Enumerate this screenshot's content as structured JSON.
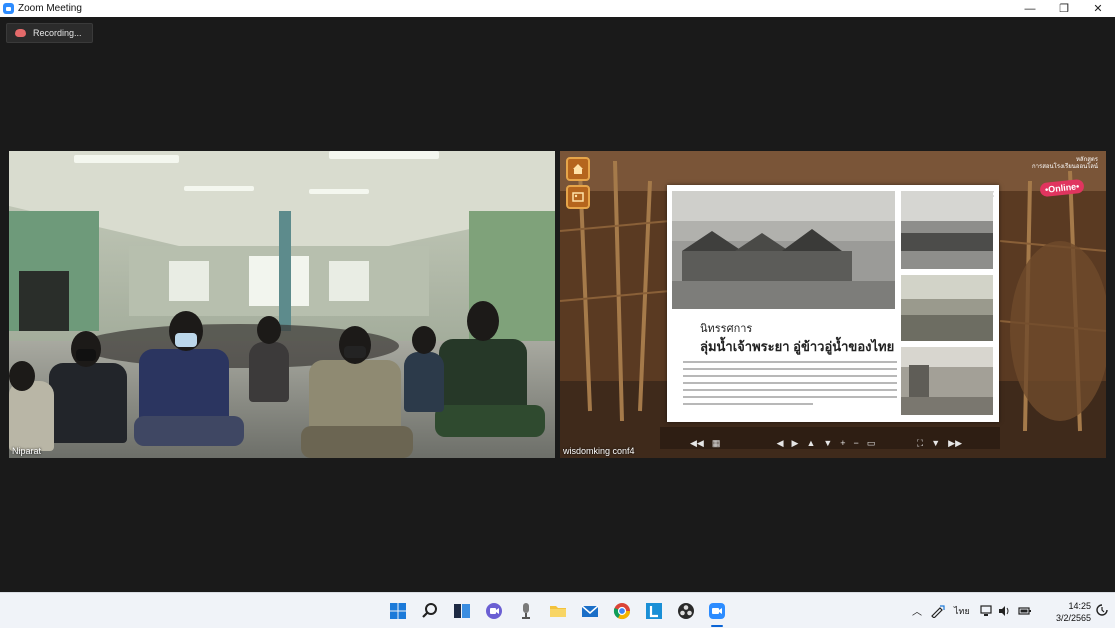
{
  "window": {
    "title": "Zoom Meeting",
    "controls": {
      "minimize": "—",
      "restore": "❐",
      "close": "✕"
    }
  },
  "meeting": {
    "recording_label": "Recording...",
    "participants": [
      {
        "name": "Niparat"
      },
      {
        "name": "wisdomking conf4"
      }
    ]
  },
  "share_content": {
    "tour_label_line1": "หลักสูตร",
    "tour_label_line2": "การสอนโรงเรียนออนไลน์",
    "online_badge": "•Online•",
    "popup": {
      "close": "×",
      "subtitle": "นิทรรศการ",
      "title": "ลุ่มน้ำเจ้าพระยา อู่ข้าวอู่น้ำของไทย"
    }
  },
  "taskbar": {
    "apps": [
      "start-icon",
      "search-icon",
      "task-view-icon",
      "chat-icon",
      "microphone-app-icon",
      "file-explorer-icon",
      "mail-icon",
      "chrome-icon",
      "line-app-icon",
      "obs-icon",
      "zoom-icon"
    ],
    "language": "ไทย",
    "time": "14:25",
    "date": "3/2/2565"
  },
  "colors": {
    "zoom_blue": "#2d8cff",
    "online_pink": "#e0355f",
    "museum_orange": "#b5651d"
  }
}
